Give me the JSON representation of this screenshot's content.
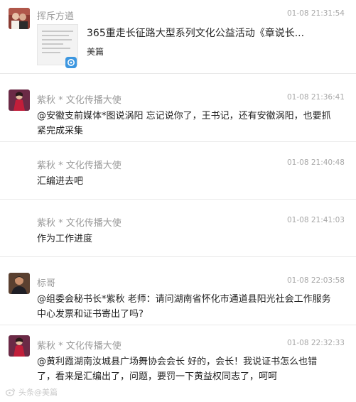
{
  "messages": [
    {
      "author": "挥斥方遒",
      "time": "01-08 21:31:54",
      "avatar_icon": "couple-photo-avatar",
      "card": {
        "title": "365重走长征路大型系列文化公益活动《章说长...",
        "source": "美篇"
      }
    },
    {
      "author": "紫秋 * 文化传播大使",
      "time": "01-08 21:36:41",
      "avatar_icon": "woman-red-dress-avatar",
      "text": "@安徽支前媒体*图说涡阳 忘记说你了，王书记，还有安徽涡阳，也要抓紧完成采集"
    },
    {
      "author": "紫秋 * 文化传播大使",
      "time": "01-08 21:40:48",
      "text": "汇编进去吧"
    },
    {
      "author": "紫秋 * 文化传播大使",
      "time": "01-08 21:41:03",
      "text": "作为工作进度"
    },
    {
      "author": "标哥",
      "time": "01-08 22:03:58",
      "avatar_icon": "man-dark-shirt-avatar",
      "text": "@组委会秘书长*紫秋 老师：请问湖南省怀化市通道县阳光社会工作服务中心发票和证书寄出了吗?"
    },
    {
      "author": "紫秋 * 文化传播大使",
      "time": "01-08 22:32:33",
      "avatar_icon": "woman-red-dress-avatar",
      "text": "@黄利霞湖南汝城县广场舞协会会长 好的，会长！我说证书怎么也错了，看来是汇编出了，问题，要罚一下黄益权同志了，呵呵"
    }
  ],
  "watermark": {
    "icon": "weibo-icon",
    "text": "头条@美篇"
  }
}
